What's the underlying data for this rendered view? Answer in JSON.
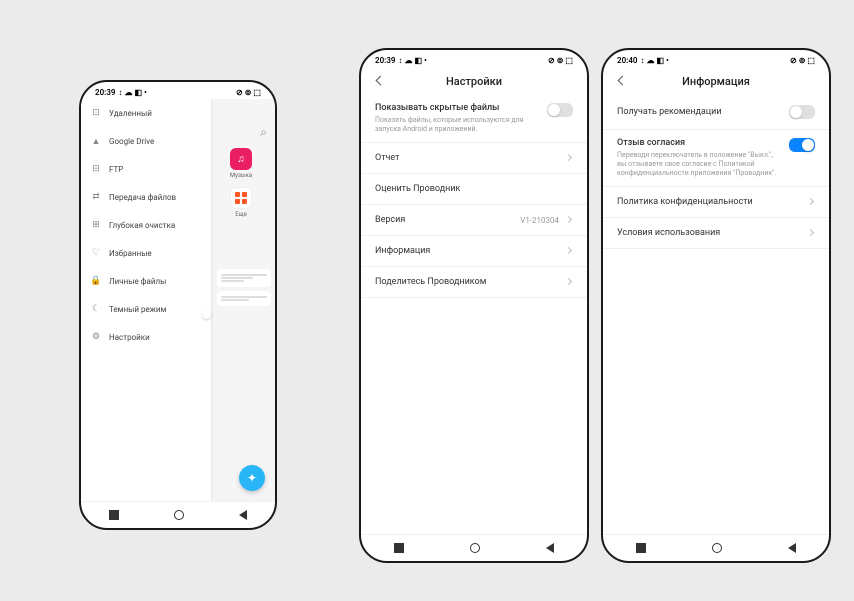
{
  "phone1": {
    "status": {
      "time": "20:39",
      "icons": "↕ ☁ ◧ •",
      "right": "⊘ ⊚ ⬚"
    },
    "drawer": [
      {
        "icon": "⊡",
        "label": "Удаленный"
      },
      {
        "icon": "▲",
        "label": "Google Drive"
      },
      {
        "icon": "⊟",
        "label": "FTP"
      },
      {
        "icon": "⇄",
        "label": "Передача файлов"
      },
      {
        "icon": "⊞",
        "label": "Глубокая очистка"
      },
      {
        "icon": "♡",
        "label": "Избранные"
      },
      {
        "icon": "🔒",
        "label": "Личные файлы"
      },
      {
        "icon": "☾",
        "label": "Темный режим",
        "toggle": true
      },
      {
        "icon": "⚙",
        "label": "Настройки"
      }
    ],
    "tiles": {
      "music": "Музыка",
      "more": "Еще"
    }
  },
  "phone2": {
    "status": {
      "time": "20:39",
      "icons": "↕ ☁ ◧ •",
      "right": "⊘ ⊚ ⬚"
    },
    "title": "Настройки",
    "hidden": {
      "title": "Показывать скрытые файлы",
      "sub": "Показать файлы, которые используются для запуска Android и приложений."
    },
    "items": {
      "report": "Отчет",
      "rate": "Оценить Проводник",
      "version_label": "Версия",
      "version_value": "V1-210304",
      "info": "Информация",
      "share": "Поделитесь Проводником"
    }
  },
  "phone3": {
    "status": {
      "time": "20:40",
      "icons": "↕ ☁ ◧ •",
      "right": "⊘ ⊚ ⬚"
    },
    "title": "Информация",
    "rec": {
      "title": "Получать рекомендации"
    },
    "consent": {
      "title": "Отзыв согласия",
      "sub": "Переводя переключатель в положение \"Выкл.\", вы отзываете свое согласие с Политикой конфиденциальности приложения \"Проводник\"."
    },
    "privacy": "Политика конфиденциальности",
    "terms": "Условия использования"
  }
}
